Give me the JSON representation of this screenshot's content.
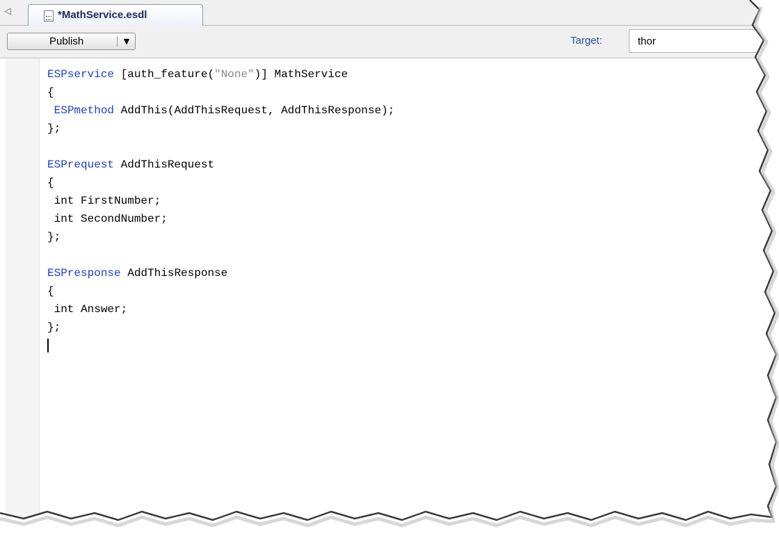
{
  "tab": {
    "title": "*MathService.esdl"
  },
  "toolbar": {
    "publish_label": "Publish",
    "dropdown_glyph": "▼",
    "target_label": "Target:",
    "target_value": "thor"
  },
  "icons": {
    "tab_scroll_left": "◁",
    "file_icon": "document-icon"
  },
  "colors": {
    "keyword": "#1d3fcf",
    "string": "#8a8a8a",
    "tab_title": "#1a2a5a",
    "target_label": "#2a4fa0"
  },
  "code": {
    "l1": {
      "kw": "ESPservice",
      "a": " [auth_feature(",
      "s": "\"None\"",
      "b": ")] MathService"
    },
    "l2": "{",
    "l3": {
      "pre": " ",
      "kw": "ESPmethod",
      "rest": " AddThis(AddThisRequest, AddThisResponse);"
    },
    "l4": "};",
    "l5": "",
    "l6": {
      "kw": "ESPrequest",
      "rest": " AddThisRequest"
    },
    "l7": "{",
    "l8": " int FirstNumber;",
    "l9": " int SecondNumber;",
    "l10": "};",
    "l11": "",
    "l12": {
      "kw": "ESPresponse",
      "rest": " AddThisResponse"
    },
    "l13": "{",
    "l14": " int Answer;",
    "l15": "};"
  }
}
